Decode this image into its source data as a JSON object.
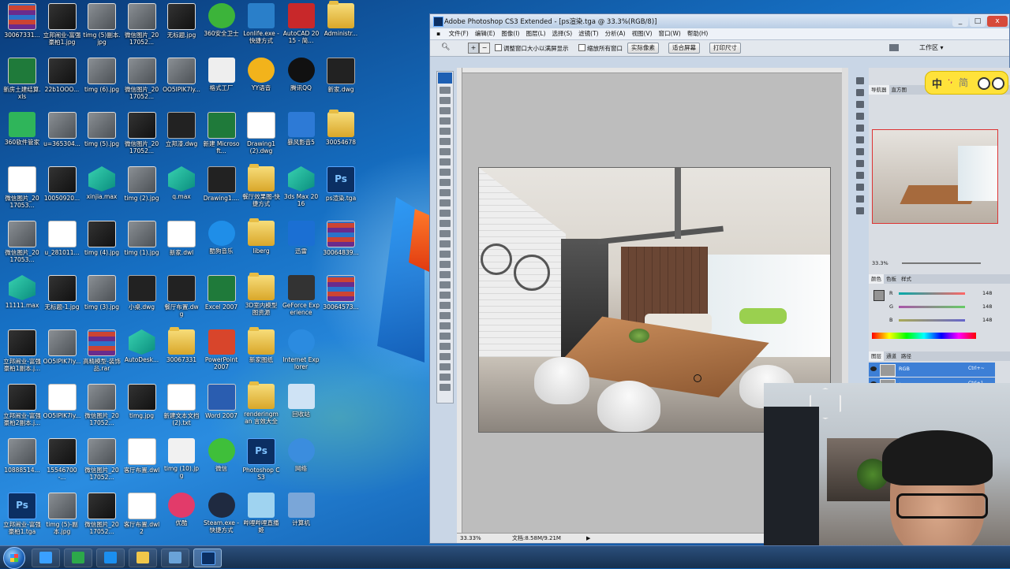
{
  "desktop": {
    "icons": [
      {
        "label": "30067331...",
        "type": "rar",
        "col": 0,
        "row": 0
      },
      {
        "label": "立邦闹业-富强豪柏1.jpg",
        "type": "darkimg",
        "col": 1,
        "row": 0
      },
      {
        "label": "timg (5)副本.jpg",
        "type": "photo",
        "col": 2,
        "row": 0
      },
      {
        "label": "微信图片_2017052...",
        "type": "photo",
        "col": 3,
        "row": 0
      },
      {
        "label": "无标题.jpg",
        "type": "darkimg",
        "col": 4,
        "row": 0
      },
      {
        "label": "360安全卫士",
        "type": "safe360",
        "col": 5,
        "row": 0
      },
      {
        "label": "Lonlife.exe - 快捷方式",
        "type": "lonlife",
        "col": 6,
        "row": 0
      },
      {
        "label": "AutoCAD 2015 - 简...",
        "type": "autocad",
        "col": 7,
        "row": 0
      },
      {
        "label": "Administr...",
        "type": "folder",
        "col": 8,
        "row": 0
      },
      {
        "label": "新房土建结算.xls",
        "type": "excel",
        "col": 0,
        "row": 1
      },
      {
        "label": "22b1OOO...",
        "type": "darkimg",
        "col": 1,
        "row": 1
      },
      {
        "label": "timg (6).jpg",
        "type": "photo",
        "col": 2,
        "row": 1
      },
      {
        "label": "微信图片_2017052...",
        "type": "photo",
        "col": 3,
        "row": 1
      },
      {
        "label": "OO5IPIK7ly...",
        "type": "photo",
        "col": 4,
        "row": 1
      },
      {
        "label": "格式工厂",
        "type": "format",
        "col": 5,
        "row": 1
      },
      {
        "label": "YY语音",
        "type": "yy",
        "col": 6,
        "row": 1
      },
      {
        "label": "腾讯QQ",
        "type": "qq",
        "col": 7,
        "row": 1
      },
      {
        "label": "新家.dwg",
        "type": "dwg",
        "col": 8,
        "row": 1
      },
      {
        "label": "360软件管家",
        "type": "soft360",
        "col": 0,
        "row": 2
      },
      {
        "label": "u=365304...",
        "type": "photo",
        "col": 1,
        "row": 2
      },
      {
        "label": "timg (5).jpg",
        "type": "photo",
        "col": 2,
        "row": 2
      },
      {
        "label": "微信图片_2017052...",
        "type": "darkimg",
        "col": 3,
        "row": 2
      },
      {
        "label": "立邦漆.dwg",
        "type": "dwg",
        "col": 4,
        "row": 2
      },
      {
        "label": "新建 Microsoft...",
        "type": "excel",
        "col": 5,
        "row": 2
      },
      {
        "label": "Drawing1 (2).dwg",
        "type": "doc",
        "col": 6,
        "row": 2
      },
      {
        "label": "暴风影音5",
        "type": "storm",
        "col": 7,
        "row": 2
      },
      {
        "label": "30054678",
        "type": "folder",
        "col": 8,
        "row": 2
      },
      {
        "label": "微信图片_2017053...",
        "type": "doc",
        "col": 0,
        "row": 3
      },
      {
        "label": "10050920...",
        "type": "darkimg",
        "col": 1,
        "row": 3
      },
      {
        "label": "xinjia.max",
        "type": "max",
        "col": 2,
        "row": 3
      },
      {
        "label": "timg (2).jpg",
        "type": "photo",
        "col": 3,
        "row": 3
      },
      {
        "label": "q.max",
        "type": "max",
        "col": 4,
        "row": 3
      },
      {
        "label": "Drawing1....",
        "type": "dwg",
        "col": 5,
        "row": 3
      },
      {
        "label": "餐厅效果图-快捷方式",
        "type": "folder",
        "col": 6,
        "row": 3
      },
      {
        "label": "3ds Max 2016",
        "type": "max",
        "col": 7,
        "row": 3
      },
      {
        "label": "ps渲染.tga",
        "type": "ps",
        "col": 8,
        "row": 3
      },
      {
        "label": "微信图片_2017053...",
        "type": "photo",
        "col": 0,
        "row": 4
      },
      {
        "label": "u_281011...",
        "type": "doc",
        "col": 1,
        "row": 4
      },
      {
        "label": "timg (4).jpg",
        "type": "darkimg",
        "col": 2,
        "row": 4
      },
      {
        "label": "timg (1).jpg",
        "type": "photo",
        "col": 3,
        "row": 4
      },
      {
        "label": "新家.dwl",
        "type": "doc",
        "col": 4,
        "row": 4
      },
      {
        "label": "酷狗音乐",
        "type": "kugou",
        "col": 5,
        "row": 4
      },
      {
        "label": "liberg",
        "type": "folder",
        "col": 6,
        "row": 4
      },
      {
        "label": "迅雷",
        "type": "xunlei",
        "col": 7,
        "row": 4
      },
      {
        "label": "30064839...",
        "type": "rar",
        "col": 8,
        "row": 4
      },
      {
        "label": "11111.max",
        "type": "max",
        "col": 0,
        "row": 5
      },
      {
        "label": "无标题-1.jpg",
        "type": "darkimg",
        "col": 1,
        "row": 5
      },
      {
        "label": "timg (3).jpg",
        "type": "photo",
        "col": 2,
        "row": 5
      },
      {
        "label": "小桌.dwg",
        "type": "dwg",
        "col": 3,
        "row": 5
      },
      {
        "label": "餐厅布置.dwg",
        "type": "dwg",
        "col": 4,
        "row": 5
      },
      {
        "label": "Excel 2007",
        "type": "excel",
        "col": 5,
        "row": 5
      },
      {
        "label": "3D室内模型图资源",
        "type": "folder",
        "col": 6,
        "row": 5
      },
      {
        "label": "GeForce Experience",
        "type": "geforce",
        "col": 7,
        "row": 5
      },
      {
        "label": "30064573...",
        "type": "rar",
        "col": 8,
        "row": 5
      },
      {
        "label": "立邦闹业-富强豪柏1副本.j...",
        "type": "darkimg",
        "col": 0,
        "row": 6
      },
      {
        "label": "OO5IPIK7ly...",
        "type": "photo",
        "col": 1,
        "row": 6
      },
      {
        "label": "高精模型-装饰品.rar",
        "type": "rar",
        "col": 2,
        "row": 6
      },
      {
        "label": "AutoDesk...",
        "type": "max",
        "col": 3,
        "row": 6
      },
      {
        "label": "30067331",
        "type": "folder",
        "col": 4,
        "row": 6
      },
      {
        "label": "PowerPoint 2007",
        "type": "ppt",
        "col": 5,
        "row": 6
      },
      {
        "label": "新家图纸",
        "type": "folder",
        "col": 6,
        "row": 6
      },
      {
        "label": "Internet Explorer",
        "type": "ie",
        "col": 7,
        "row": 6
      },
      {
        "label": "立邦闹业-富强豪柏2副本.j...",
        "type": "darkimg",
        "col": 0,
        "row": 7
      },
      {
        "label": "OO5IPIK7ly...",
        "type": "doc",
        "col": 1,
        "row": 7
      },
      {
        "label": "微信图片_2017052...",
        "type": "photo",
        "col": 2,
        "row": 7
      },
      {
        "label": "timg.jpg",
        "type": "darkimg",
        "col": 3,
        "row": 7
      },
      {
        "label": "新建文本文档 (2).txt",
        "type": "doc",
        "col": 4,
        "row": 7
      },
      {
        "label": "Word 2007",
        "type": "word",
        "col": 5,
        "row": 7
      },
      {
        "label": "renderingman 言效大全",
        "type": "folder",
        "col": 6,
        "row": 7
      },
      {
        "label": "回收站",
        "type": "recycle",
        "col": 7,
        "row": 7
      },
      {
        "label": "10888514...",
        "type": "photo",
        "col": 0,
        "row": 8
      },
      {
        "label": "15546700-...",
        "type": "darkimg",
        "col": 1,
        "row": 8
      },
      {
        "label": "微信图片_2017052...",
        "type": "photo",
        "col": 2,
        "row": 8
      },
      {
        "label": "客厅布置.dwl",
        "type": "doc",
        "col": 3,
        "row": 8
      },
      {
        "label": "timg (10).jpg",
        "type": "face",
        "col": 4,
        "row": 8
      },
      {
        "label": "微信",
        "type": "wechat",
        "col": 5,
        "row": 8
      },
      {
        "label": "Photoshop CS3",
        "type": "ps",
        "col": 6,
        "row": 8
      },
      {
        "label": "网络",
        "type": "network",
        "col": 7,
        "row": 8
      },
      {
        "label": "立邦闹业-富强豪柏1.tga",
        "type": "ps",
        "col": 0,
        "row": 9
      },
      {
        "label": "timg (5)-副本.jpg",
        "type": "photo",
        "col": 1,
        "row": 9
      },
      {
        "label": "微信图片_2017052...",
        "type": "darkimg",
        "col": 2,
        "row": 9
      },
      {
        "label": "客厅布置.dwl2",
        "type": "doc",
        "col": 3,
        "row": 9
      },
      {
        "label": "优酷",
        "type": "youku",
        "col": 4,
        "row": 9
      },
      {
        "label": "Steam.exe - 快捷方式",
        "type": "steam",
        "col": 5,
        "row": 9
      },
      {
        "label": "哔哩哔哩直播姬",
        "type": "bili",
        "col": 6,
        "row": 9
      },
      {
        "label": "计算机",
        "type": "computer",
        "col": 7,
        "row": 9
      }
    ]
  },
  "taskbar": {
    "items": [
      {
        "name": "ie",
        "color": "#3aa0ff"
      },
      {
        "name": "360-browser",
        "color": "#2ca84a"
      },
      {
        "name": "xunlei",
        "color": "#1b8ff0"
      },
      {
        "name": "explorer",
        "color": "#f0c74a"
      },
      {
        "name": "media",
        "color": "#6aa3d8"
      },
      {
        "name": "photoshop",
        "color": "#0b2f63"
      }
    ]
  },
  "photoshop": {
    "title": "Adobe Photoshop CS3 Extended - [ps渲染.tga @ 33.3%(RGB/8)]",
    "window_buttons": {
      "min": "_",
      "max": "□",
      "close": "x"
    },
    "menu": [
      "文件(F)",
      "编辑(E)",
      "图像(I)",
      "图层(L)",
      "选择(S)",
      "滤镜(T)",
      "分析(A)",
      "视图(V)",
      "窗口(W)",
      "帮助(H)"
    ],
    "options": {
      "check1": "调整窗口大小以满屏显示",
      "check2": "缩放所有窗口",
      "btn1": "实际像素",
      "btn2": "适合屏幕",
      "btn3": "打印尺寸",
      "workspace": "工作区 ▾"
    },
    "status": {
      "zoom": "33.33%",
      "doc": "文档:8.58M/9.21M"
    },
    "navigator": {
      "tabs": [
        "导航器",
        "直方图"
      ],
      "zoom": "33.3%"
    },
    "color_panel": {
      "tabs": [
        "颜色",
        "色板",
        "样式"
      ],
      "r_label": "R",
      "g_label": "G",
      "b_label": "B",
      "r": "148",
      "g": "148",
      "b": "148"
    },
    "layers_panel": {
      "tabs": [
        "图层",
        "通道",
        "路径"
      ],
      "rows": [
        {
          "name": "RGB",
          "shortcut": "Ctrl+~"
        },
        {
          "name": "红",
          "shortcut": "Ctrl+1"
        }
      ]
    }
  },
  "ime": {
    "mode": "中",
    "punct": "·,",
    "simp": "简"
  }
}
